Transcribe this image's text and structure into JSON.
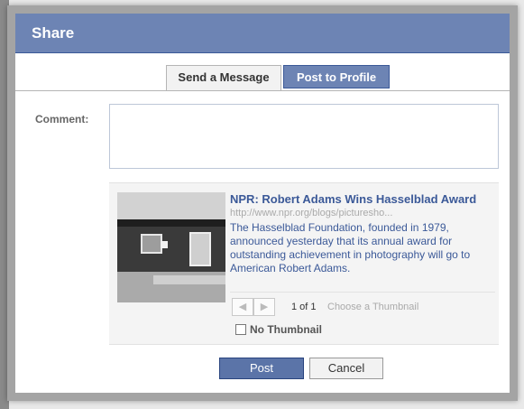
{
  "dialog": {
    "title": "Share",
    "tabs": [
      {
        "label": "Send a Message",
        "active": false
      },
      {
        "label": "Post to Profile",
        "active": true
      }
    ],
    "comment": {
      "label": "Comment:",
      "value": "",
      "placeholder": ""
    },
    "attachment": {
      "title": "NPR: Robert Adams Wins Hasselblad Award",
      "url": "http://www.npr.org/blogs/picturesho...",
      "description": "The Hasselblad Foundation, founded in 1979, announced yesterday that its annual award for outstanding achievement in photography will go to American Robert Adams.",
      "thumbnail_count": "1 of 1",
      "choose_hint": "Choose a Thumbnail",
      "no_thumbnail_label": "No Thumbnail"
    },
    "buttons": {
      "post": "Post",
      "cancel": "Cancel"
    }
  },
  "colors": {
    "header": "#6d84b4",
    "link": "#3b5998",
    "post_button": "#5b74a8"
  },
  "icons": {
    "prev": "left-arrow-icon",
    "next": "right-arrow-icon"
  }
}
